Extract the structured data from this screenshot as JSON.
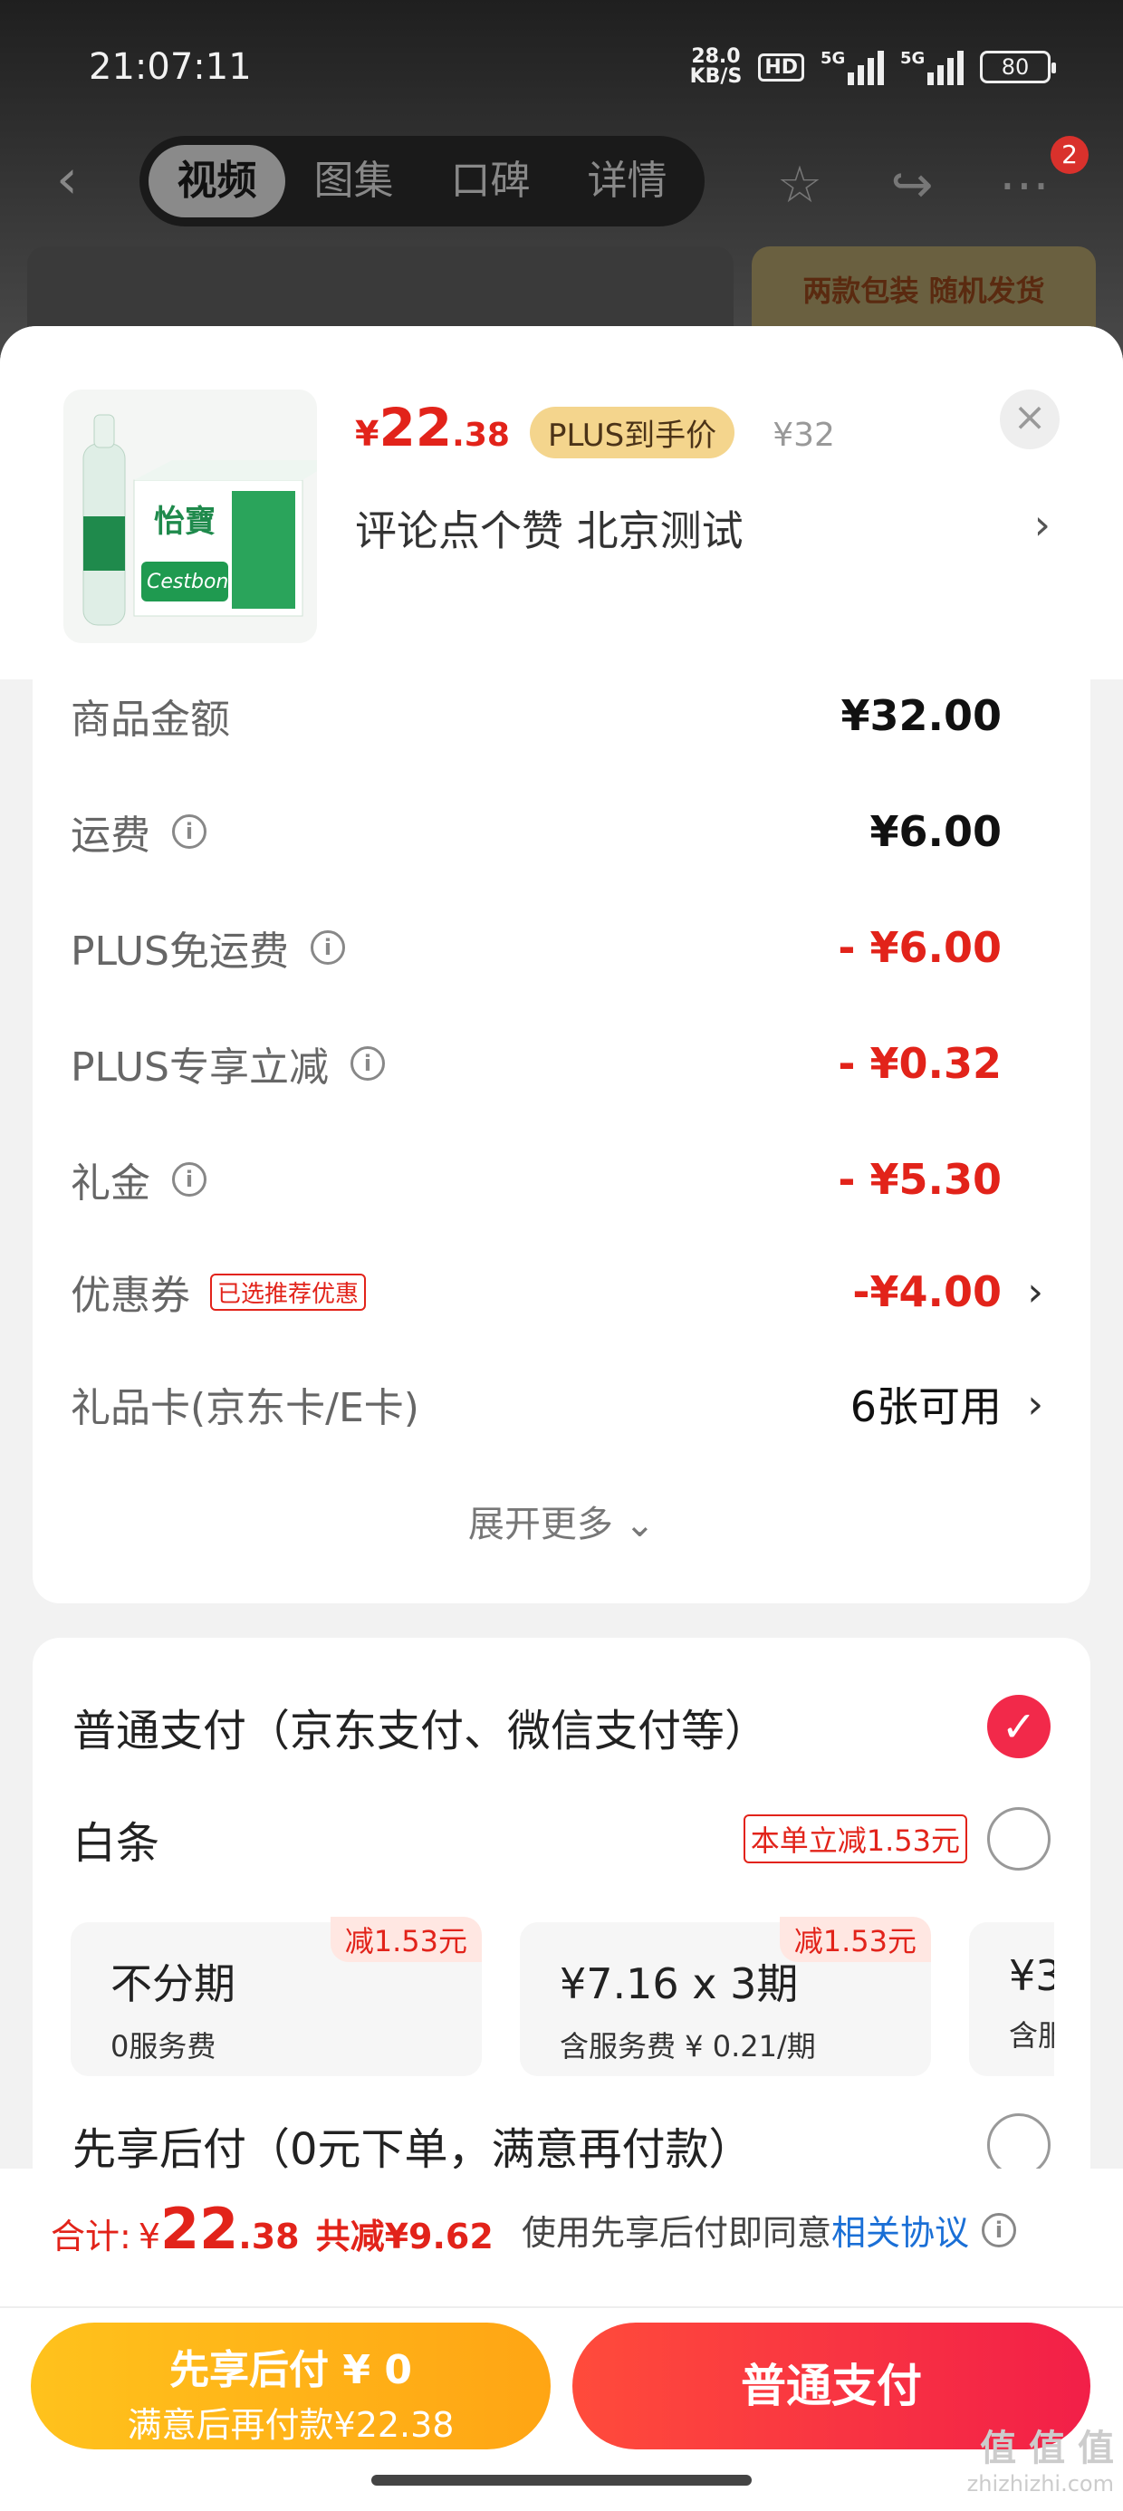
{
  "status_bar": {
    "time": "21:07:11",
    "net_speed_value": "28.0",
    "net_speed_unit": "KB/S",
    "hd": "HD",
    "sig1": "5G",
    "sig2": "5G",
    "battery": "80"
  },
  "nav": {
    "tabs": [
      {
        "label": "视频",
        "active": true
      },
      {
        "label": "图集"
      },
      {
        "label": "口碑"
      },
      {
        "label": "详情"
      }
    ],
    "badge_count": "2",
    "promo": "两款包装 随机发货"
  },
  "product": {
    "currency": "¥",
    "price_int": "22",
    "price_dec": ".38",
    "plus_tag": "PLUS到手价",
    "original_price": "¥32",
    "name": "评论点个赞  北京测试",
    "brand_text": "怡寶",
    "brand_en": "Cestbon"
  },
  "summary": {
    "rows": [
      {
        "label": "商品金额",
        "value": "¥32.00"
      },
      {
        "label": "运费",
        "value": "¥6.00"
      },
      {
        "label": "PLUS免运费",
        "value": "- ¥6.00"
      },
      {
        "label": "PLUS专享立减",
        "value": "- ¥0.32"
      },
      {
        "label": "礼金",
        "value": "- ¥5.30"
      },
      {
        "label": "优惠券",
        "tag": "已选推荐优惠",
        "value": "-¥4.00"
      },
      {
        "label": "礼品卡(京东卡/E卡)",
        "value": "6张可用"
      }
    ],
    "expand": "展开更多"
  },
  "payment": {
    "normal_label": "普通支付（京东支付、微信支付等）",
    "baitiao_label": "白条",
    "baitiao_tag": "本单立减1.53元",
    "installments": [
      {
        "title": "不分期",
        "sub": "0服务费",
        "off": "减1.53元"
      },
      {
        "title": "¥7.16 x 3期",
        "sub": "含服务费 ¥ 0.21/期",
        "off": "减1.53元"
      },
      {
        "title": "¥3",
        "sub": "含服",
        "off": ""
      }
    ],
    "later_label": "先享后付（0元下单，满意再付款）"
  },
  "footer": {
    "total_label": "合计:",
    "total_cur": "¥",
    "total_int": "22",
    "total_dec": ".38",
    "total_save": "共减¥9.62",
    "agree_text": "使用先享后付即同意",
    "agree_link": "相关协议",
    "btn_later_title": "先享后付 ¥ 0",
    "btn_later_sub": "满意后再付款¥22.38",
    "btn_pay": "普通支付",
    "watermark": "值 值 值",
    "watermark_url": "zhizhizhi.com"
  }
}
